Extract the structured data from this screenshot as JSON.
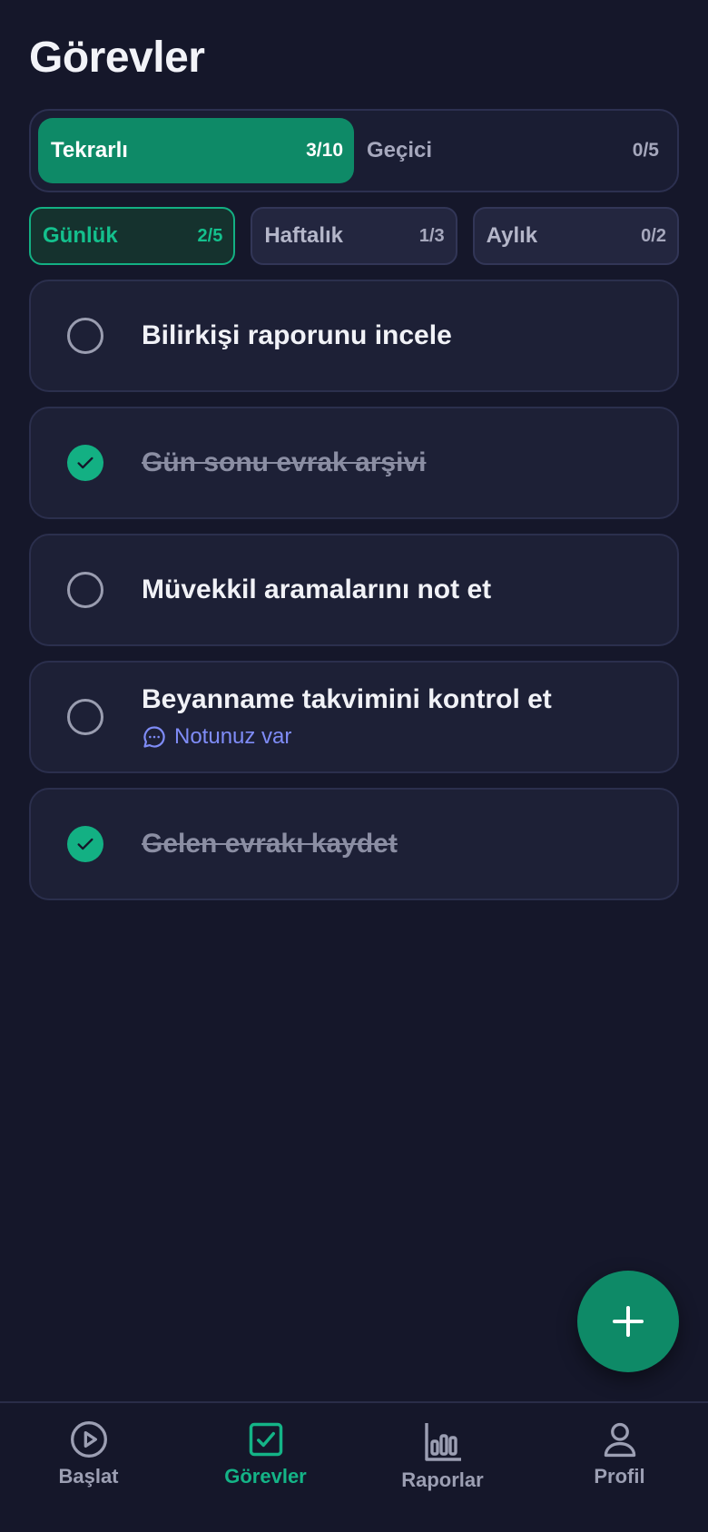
{
  "header": {
    "title": "Görevler"
  },
  "segment": {
    "tabs": [
      {
        "label": "Tekrarlı",
        "count": "3/10",
        "active": true
      },
      {
        "label": "Geçici",
        "count": "0/5",
        "active": false
      }
    ]
  },
  "periods": [
    {
      "label": "Günlük",
      "count": "2/5",
      "active": true
    },
    {
      "label": "Haftalık",
      "count": "1/3",
      "active": false
    },
    {
      "label": "Aylık",
      "count": "0/2",
      "active": false
    }
  ],
  "tasks": [
    {
      "title": "Bilirkişi raporunu incele",
      "done": false
    },
    {
      "title": "Gün sonu evrak arşivi",
      "done": true
    },
    {
      "title": "Müvekkil aramalarını not et",
      "done": false
    },
    {
      "title": "Beyanname takvimini kontrol et",
      "done": false,
      "note": "Notunuz var"
    },
    {
      "title": "Gelen evrakı kaydet",
      "done": true
    }
  ],
  "nav": {
    "items": [
      {
        "label": "Başlat",
        "icon": "play-circle-icon",
        "active": false
      },
      {
        "label": "Görevler",
        "icon": "checkbox-icon",
        "active": true
      },
      {
        "label": "Raporlar",
        "icon": "bar-chart-icon",
        "active": false
      },
      {
        "label": "Profil",
        "icon": "user-icon",
        "active": false
      }
    ]
  },
  "colors": {
    "background": "#15172a",
    "accent": "#0e8a67",
    "accent_bright": "#13b083",
    "note": "#7f8cf7"
  }
}
